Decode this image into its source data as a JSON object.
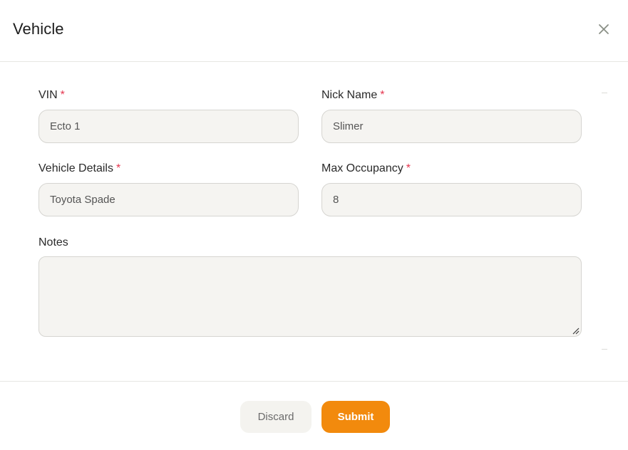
{
  "modal": {
    "title": "Vehicle",
    "close_icon": "close-icon"
  },
  "form": {
    "vin": {
      "label": "VIN",
      "required_mark": "*",
      "value": "Ecto 1"
    },
    "nick_name": {
      "label": "Nick Name",
      "required_mark": "*",
      "value": "Slimer"
    },
    "vehicle_details": {
      "label": "Vehicle Details",
      "required_mark": "*",
      "value": "Toyota Spade"
    },
    "max_occupancy": {
      "label": "Max Occupancy",
      "required_mark": "*",
      "value": "8"
    },
    "notes": {
      "label": "Notes",
      "value": ""
    }
  },
  "footer": {
    "discard_label": "Discard",
    "submit_label": "Submit"
  },
  "colors": {
    "accent": "#f28a0d",
    "required": "#e5364f",
    "input_bg": "#f5f4f1",
    "input_border": "#d6d5d1"
  }
}
